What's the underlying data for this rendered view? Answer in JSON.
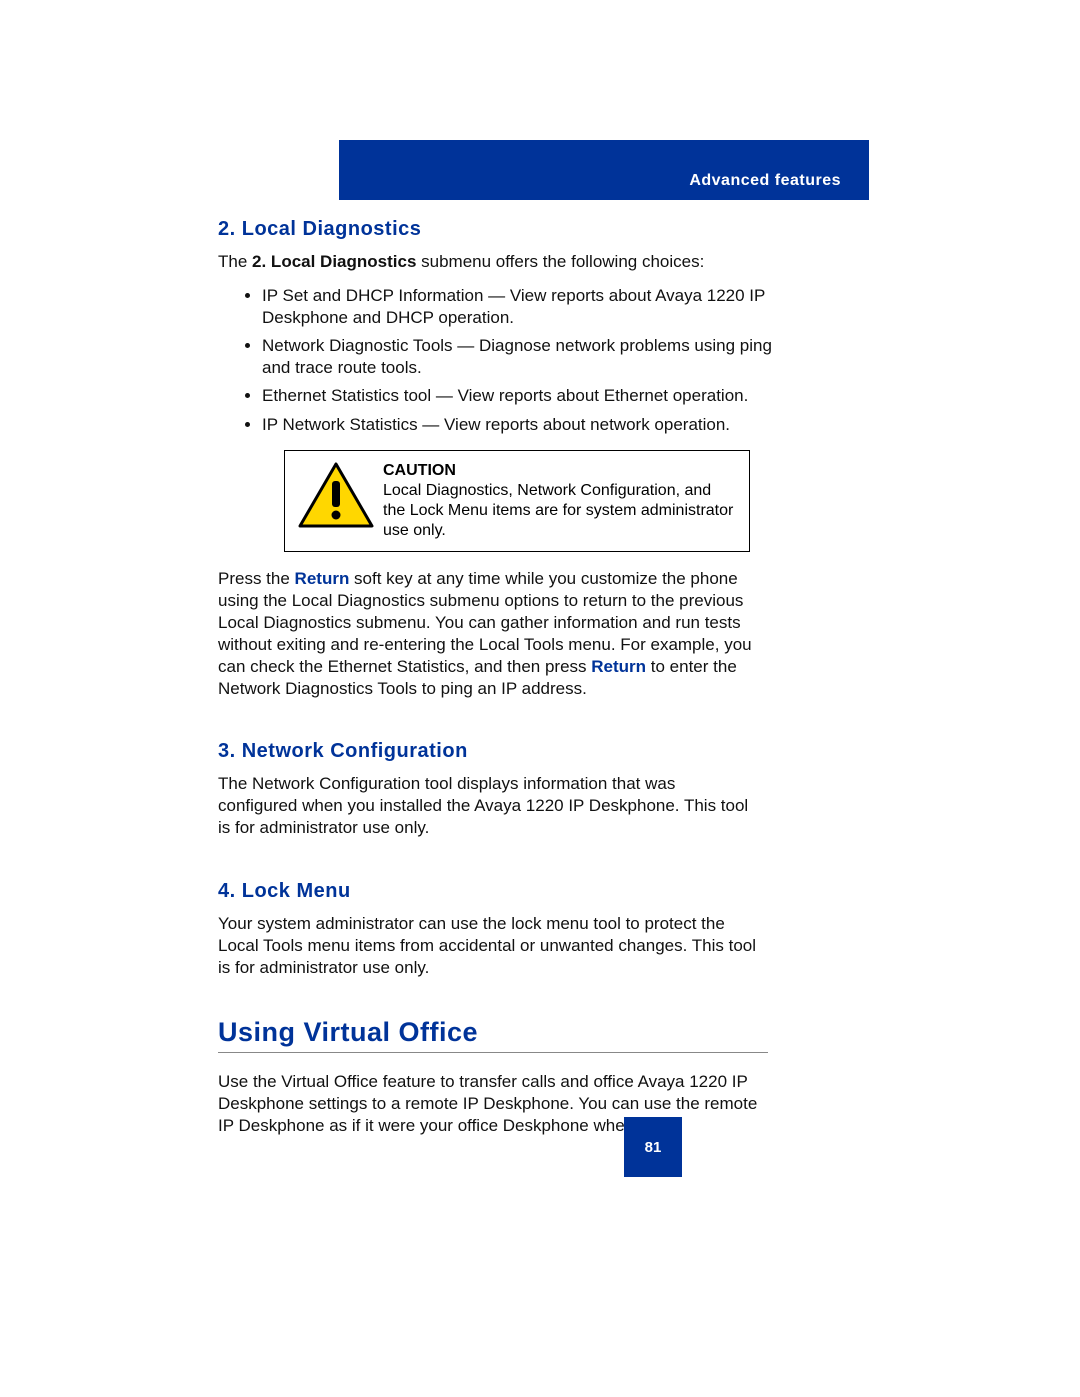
{
  "header": {
    "label": "Advanced features"
  },
  "section_local": {
    "title": "2. Local Diagnostics",
    "intro_pre": "The ",
    "intro_bold": "2. Local Diagnostics",
    "intro_post": " submenu offers the following choices:",
    "bullets": [
      "IP Set and DHCP Information — View reports about Avaya 1220 IP Deskphone and DHCP operation.",
      "Network Diagnostic Tools — Diagnose network problems using ping and trace route tools.",
      "Ethernet Statistics tool — View reports about Ethernet operation.",
      "IP Network Statistics — View reports about network operation."
    ],
    "caution_title": "CAUTION",
    "caution_body": "Local Diagnostics, Network Configuration, and the Lock Menu items are for system administrator use only.",
    "return_para": {
      "p1": "Press the ",
      "r1": "Return",
      "p2": " soft key at any time while you customize the phone using the Local Diagnostics submenu options to return to the previous Local Diagnostics submenu. You can gather information and run tests without exiting and re-entering the Local Tools menu. For example, you can check the Ethernet Statistics, and then press ",
      "r2": "Return",
      "p3": " to enter the Network Diagnostics Tools to ping an IP address."
    }
  },
  "section_net": {
    "title": "3. Network Configuration",
    "body": "The Network Configuration tool displays information that was configured when you installed the Avaya 1220 IP Deskphone. This tool is for administrator use only."
  },
  "section_lock": {
    "title": "4. Lock Menu",
    "body": "Your system administrator can use the lock menu tool to protect the Local Tools menu items from accidental or unwanted changes. This tool is for administrator use only."
  },
  "section_vo": {
    "title": "Using Virtual Office",
    "body": "Use the Virtual Office feature to transfer calls and office Avaya 1220 IP Deskphone settings to a remote IP Deskphone. You can use the remote IP Deskphone as if it were your office Deskphone when"
  },
  "footer": {
    "page_number": "81"
  }
}
